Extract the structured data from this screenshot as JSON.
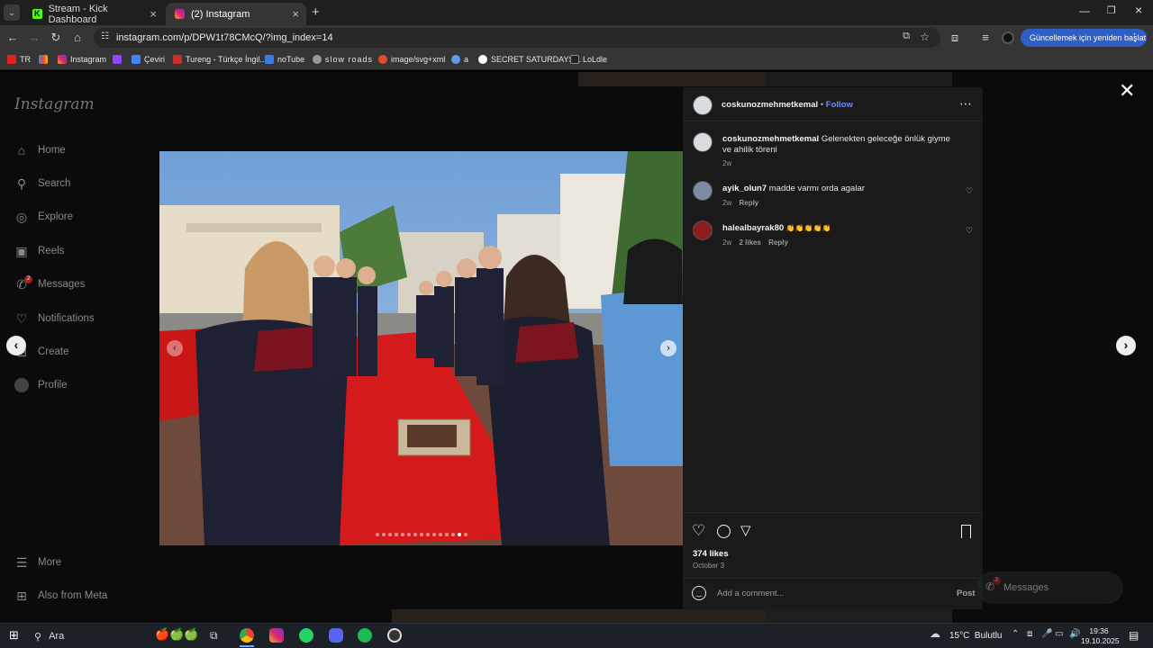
{
  "browser": {
    "tabs": [
      {
        "title": "Stream - Kick Dashboard",
        "active": false
      },
      {
        "title": "(2) Instagram",
        "active": true
      }
    ],
    "url": "instagram.com/p/DPW1t78CMcQ/?img_index=14",
    "update_button": "Güncellemek için yeniden başlat",
    "bookmarks": [
      "TR",
      "Instagram",
      "Çeviri",
      "Tureng - Türkçe İngil...",
      "noTube",
      "slow roads",
      "image/svg+xml",
      "a",
      "SECRET SATURDAYS...",
      "LoLdle"
    ]
  },
  "instagram": {
    "logo": "Instagram",
    "nav": [
      {
        "label": "Home",
        "icon": "home-icon"
      },
      {
        "label": "Search",
        "icon": "search-icon"
      },
      {
        "label": "Explore",
        "icon": "compass-icon"
      },
      {
        "label": "Reels",
        "icon": "reels-icon"
      },
      {
        "label": "Messages",
        "icon": "messenger-icon",
        "badge": "2"
      },
      {
        "label": "Notifications",
        "icon": "heart-icon"
      },
      {
        "label": "Create",
        "icon": "plus-icon"
      },
      {
        "label": "Profile",
        "icon": "avatar-icon"
      }
    ],
    "more": "More",
    "meta": "Also from Meta",
    "messages_pill": "Messages",
    "messages_badge": "2"
  },
  "post": {
    "username": "coskunozmehmetkemal",
    "follow": "Follow",
    "caption_user": "coskunozmehmetkemal",
    "caption": "Gelenekten geleceğe önlük giyme ve ahilik töreni",
    "caption_time": "2w",
    "comments": [
      {
        "user": "ayik_olun7",
        "text": "madde varmı orda agalar",
        "time": "2w",
        "likes": "",
        "reply": "Reply"
      },
      {
        "user": "halealbayrak80",
        "text": "👏👏👏👏👏",
        "time": "2w",
        "likes": "2 likes",
        "reply": "Reply"
      }
    ],
    "likes": "374 likes",
    "date": "October 3",
    "add_comment_placeholder": "Add a comment...",
    "post_button": "Post",
    "carousel_dots": 15,
    "carousel_active": 13
  },
  "taskbar": {
    "search": "Ara",
    "weather": "15°C  Bulutlu",
    "time": "19:36",
    "date": "19.10.2025"
  }
}
